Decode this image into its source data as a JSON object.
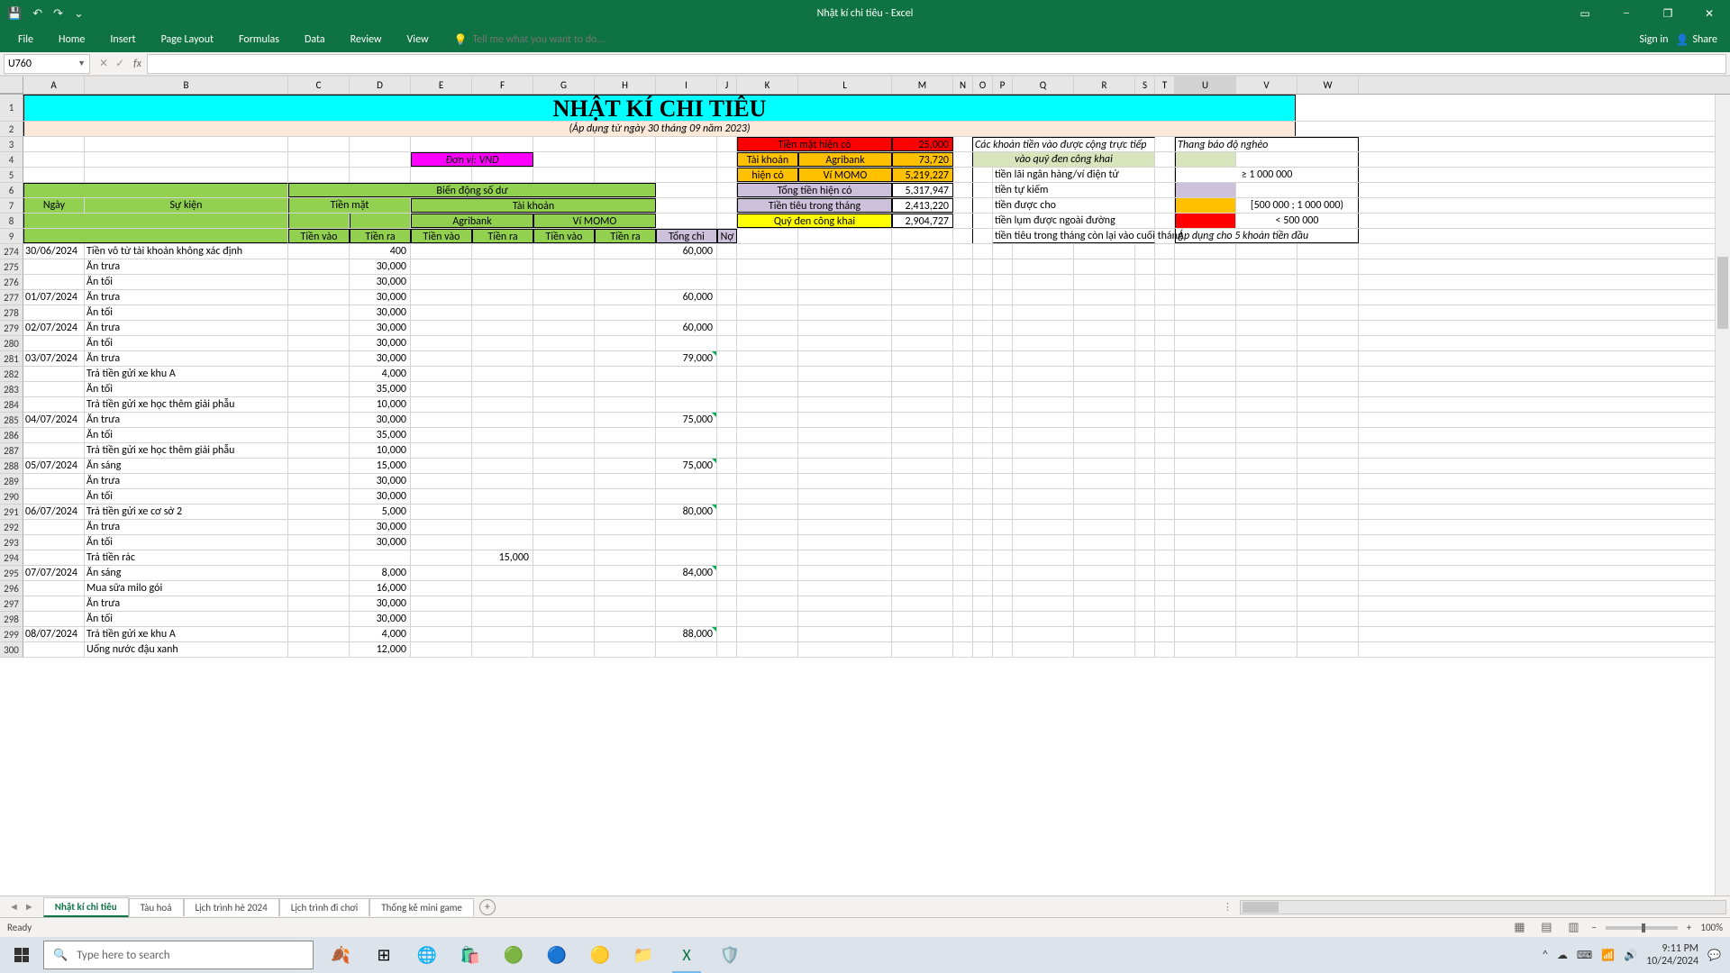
{
  "app": {
    "title": "Nhật kí chi tiêu - Excel"
  },
  "qat": {
    "undo": "↶",
    "redo": "↷",
    "more": "⌄"
  },
  "tabs": {
    "file": "File",
    "home": "Home",
    "insert": "Insert",
    "pagelayout": "Page Layout",
    "formulas": "Formulas",
    "data": "Data",
    "review": "Review",
    "view": "View"
  },
  "tellme": {
    "placeholder": "Tell me what you want to do..."
  },
  "ribbon_right": {
    "signin": "Sign in",
    "share": "Share"
  },
  "namebox": "U760",
  "formula": "",
  "fx": "fx",
  "cols": [
    "A",
    "B",
    "C",
    "D",
    "E",
    "F",
    "G",
    "H",
    "I",
    "J",
    "K",
    "L",
    "M",
    "N",
    "O",
    "P",
    "Q",
    "R",
    "S",
    "T",
    "U",
    "V",
    "W"
  ],
  "row_headers_top": [
    "1",
    "2",
    "3",
    "4",
    "5",
    "6",
    "7",
    "8",
    "9"
  ],
  "header": {
    "title": "NHẬT KÍ CHI TIÊU",
    "subtitle": "(Áp dụng từ ngày 30 tháng 09 năm 2023)",
    "unit": "Đơn vị: VND",
    "ngay": "Ngày",
    "sukien": "Sự kiện",
    "biendong": "Biến động số dư",
    "tienmat": "Tiền mặt",
    "taikhoan": "Tài khoản",
    "agribank": "Agribank",
    "vimomo": "Ví MOMO",
    "tienvao": "Tiền vào",
    "tienra": "Tiền ra",
    "tongchi": "Tổng chi",
    "no": "Nợ"
  },
  "summary": {
    "r3_k": "Tiền mặt hiện có",
    "r3_m": "25,000",
    "r4_k": "Tài khoản",
    "r4_l": "Agribank",
    "r4_m": "73,720",
    "r5_k": "hiện có",
    "r5_l": "Ví MOMO",
    "r5_m": "5,219,227",
    "r6_k": "Tổng tiền hiện có",
    "r6_m": "5,317,947",
    "r7_k": "Tiền tiêu trong tháng",
    "r7_m": "2,413,220",
    "r8_k": "Quỹ đen công khai",
    "r8_m": "2,904,727"
  },
  "notes": {
    "r3": "Các khoản tiền vào được cộng trực tiếp",
    "r4": "vào quỹ đen công khai",
    "r5": "tiền lãi ngân hàng/ví điện tử",
    "r6": "tiền tự kiếm",
    "r7": "tiền được cho",
    "r8": "tiền lụm được ngoài đường",
    "r9": "tiền tiêu trong tháng còn lại vào cuối tháng"
  },
  "legend": {
    "r3": "Thang báo độ nghèo",
    "r5": "≥ 1 000 000",
    "r7": "[500 000 ; 1 000 000)",
    "r8": "< 500 000",
    "r9": "Áp dụng cho 5 khoản tiền đầu"
  },
  "rows": [
    {
      "rn": "274",
      "a": "30/06/2024",
      "b": "Tiền vô từ tài khoản không xác định",
      "c": "",
      "d": "400",
      "i": "60,000"
    },
    {
      "rn": "275",
      "b": "Ăn trưa",
      "d": "30,000"
    },
    {
      "rn": "276",
      "b": "Ăn tối",
      "d": "30,000"
    },
    {
      "rn": "277",
      "a": "01/07/2024",
      "b": "Ăn trưa",
      "d": "30,000",
      "i": "60,000"
    },
    {
      "rn": "278",
      "b": "Ăn tối",
      "d": "30,000"
    },
    {
      "rn": "279",
      "a": "02/07/2024",
      "b": "Ăn trưa",
      "d": "30,000",
      "i": "60,000"
    },
    {
      "rn": "280",
      "b": "Ăn tối",
      "d": "30,000"
    },
    {
      "rn": "281",
      "a": "03/07/2024",
      "b": "Ăn trưa",
      "d": "30,000",
      "i": "79,000",
      "tri": true
    },
    {
      "rn": "282",
      "b": "Trả tiền gửi xe khu A",
      "d": "4,000"
    },
    {
      "rn": "283",
      "b": "Ăn tối",
      "d": "35,000"
    },
    {
      "rn": "284",
      "b": "Trả tiền gửi xe học thêm giải phẫu",
      "d": "10,000"
    },
    {
      "rn": "285",
      "a": "04/07/2024",
      "b": "Ăn trưa",
      "d": "30,000",
      "i": "75,000",
      "tri": true
    },
    {
      "rn": "286",
      "b": "Ăn tối",
      "d": "35,000"
    },
    {
      "rn": "287",
      "b": "Trả tiền gửi xe học thêm giải phẫu",
      "d": "10,000"
    },
    {
      "rn": "288",
      "a": "05/07/2024",
      "b": "Ăn sáng",
      "d": "15,000",
      "i": "75,000",
      "tri": true
    },
    {
      "rn": "289",
      "b": "Ăn trưa",
      "d": "30,000"
    },
    {
      "rn": "290",
      "b": "Ăn tối",
      "d": "30,000"
    },
    {
      "rn": "291",
      "a": "06/07/2024",
      "b": "Trả tiền gửi xe cơ sở 2",
      "d": "5,000",
      "i": "80,000",
      "tri": true
    },
    {
      "rn": "292",
      "b": "Ăn trưa",
      "d": "30,000"
    },
    {
      "rn": "293",
      "b": "Ăn tối",
      "d": "30,000"
    },
    {
      "rn": "294",
      "b": "Trả tiền rác",
      "f": "15,000"
    },
    {
      "rn": "295",
      "a": "07/07/2024",
      "b": "Ăn sáng",
      "d": "8,000",
      "i": "84,000",
      "tri": true
    },
    {
      "rn": "296",
      "b": "Mua sữa milo gói",
      "d": "16,000"
    },
    {
      "rn": "297",
      "b": "Ăn trưa",
      "d": "30,000"
    },
    {
      "rn": "298",
      "b": "Ăn tối",
      "d": "30,000"
    },
    {
      "rn": "299",
      "a": "08/07/2024",
      "b": "Trả tiền gửi xe khu A",
      "d": "4,000",
      "i": "88,000",
      "tri": true
    },
    {
      "rn": "300",
      "b": "Uống nước đậu xanh",
      "d": "12,000"
    }
  ],
  "sheets": [
    "Nhật kí chi tiêu",
    "Tàu hoả",
    "Lịch trình hè 2024",
    "Lịch trình đi chơi",
    "Thống kê mini game"
  ],
  "status": {
    "ready": "Ready",
    "zoom": "100%"
  },
  "taskbar": {
    "search": "Type here to search",
    "time": "9:11 PM",
    "date": "10/24/2024"
  }
}
